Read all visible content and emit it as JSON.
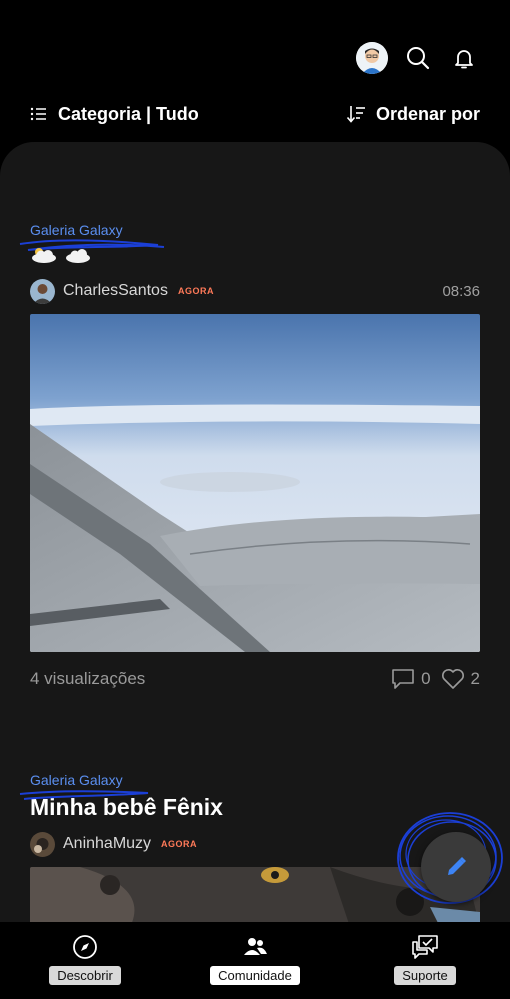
{
  "header": {
    "filter_label": "Categoria | Tudo",
    "sort_label": "Ordenar por",
    "icons": [
      "profile-avatar",
      "search-icon",
      "bell-icon",
      "list-icon",
      "sort-icon"
    ]
  },
  "posts": [
    {
      "category": "Galeria Galaxy",
      "emoji_names": [
        "sun-cloud-icon",
        "cloud-icon"
      ],
      "author": "CharlesSantos",
      "badge": "AGORA",
      "time": "08:36",
      "views": "4 visualizações",
      "comments": "0",
      "likes": "2"
    },
    {
      "category": "Galeria Galaxy",
      "title": "Minha bebê Fênix",
      "author": "AninhaMuzy",
      "badge": "AGORA"
    }
  ],
  "fab": {
    "icon": "pencil-icon"
  },
  "nav": [
    {
      "label": "Descobrir",
      "icon": "compass-icon"
    },
    {
      "label": "Comunidade",
      "icon": "people-icon",
      "active": true
    },
    {
      "label": "Suporte",
      "icon": "chat-bubbles-icon"
    }
  ],
  "colors": {
    "accent": "#5b8ff0",
    "badge": "#ff7a59",
    "background": "#000000",
    "card": "#171717"
  }
}
